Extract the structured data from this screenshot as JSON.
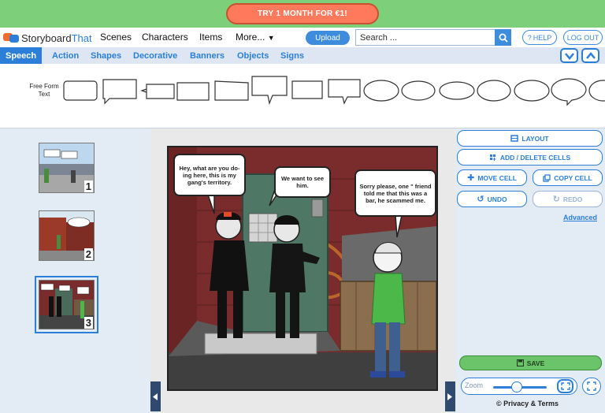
{
  "promo": {
    "label": "TRY 1 MONTH FOR €1!"
  },
  "brand": {
    "name_part1": "Storyboard",
    "name_part2": "That"
  },
  "nav": {
    "items": [
      "Scenes",
      "Characters",
      "Items",
      "More..."
    ],
    "upload_label": "Upload",
    "search_placeholder": "Search ...",
    "help_label": "HELP",
    "logout_label": "LOG OUT"
  },
  "tabs": [
    "Speech",
    "Action",
    "Shapes",
    "Decorative",
    "Banners",
    "Objects",
    "Signs"
  ],
  "palette": {
    "freeform_label": "Free Form Text"
  },
  "storyboard": {
    "cells": [
      {
        "number": "1"
      },
      {
        "number": "2"
      },
      {
        "number": "3"
      }
    ],
    "selected_cell": 3
  },
  "scene": {
    "bubbles": [
      "Hey, what are you do- ing here, this is my gang's territory.",
      "We want to see him.",
      "Sorry please, one \" friend told me that this was a bar, he scammed me."
    ]
  },
  "panel": {
    "layout": "LAYOUT",
    "add_delete": "ADD / DELETE CELLS",
    "move": "MOVE CELL",
    "copy": "COPY CELL",
    "undo": "UNDO",
    "redo": "REDO",
    "advanced": "Advanced",
    "save": "SAVE",
    "zoom": "Zoom",
    "privacy": "© Privacy & Terms"
  },
  "colors": {
    "accent": "#2b7fd8",
    "promo_bg": "#7ecf7a",
    "promo_button": "#ff7a5c",
    "save": "#6cc46a"
  }
}
